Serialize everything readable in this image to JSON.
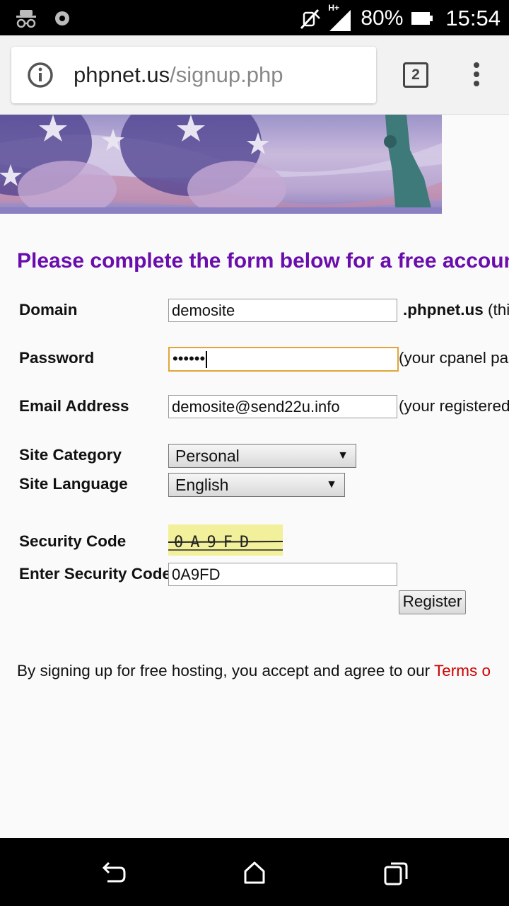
{
  "status_bar": {
    "battery": "80%",
    "time": "15:54",
    "network": "H+",
    "icons": [
      "incognito-icon",
      "sync-icon",
      "mute-icon",
      "signal-icon",
      "battery-icon"
    ]
  },
  "browser": {
    "url_host": "phpnet.us",
    "url_path": "/signup.php",
    "tab_count": "2"
  },
  "form": {
    "heading": "Please complete the form below for a free accoun",
    "domain": {
      "label": "Domain",
      "value": "demosite",
      "suffix_bold": ".phpnet.us",
      "suffix_note": "(thi"
    },
    "password": {
      "label": "Password",
      "value": "••••••",
      "suffix": "(your cpanel pa"
    },
    "email": {
      "label": "Email Address",
      "value": "demosite@send22u.info",
      "suffix": "(your registered"
    },
    "site_category": {
      "label": "Site Category",
      "selected": "Personal"
    },
    "site_language": {
      "label": "Site Language",
      "selected": "English"
    },
    "security_code": {
      "label": "Security Code",
      "captcha_text": "0A9FD"
    },
    "enter_security_code": {
      "label": "Enter Security Code",
      "value": "0A9FD"
    },
    "register_label": "Register"
  },
  "agreement": {
    "text": "By signing up for free hosting, you accept and agree to our ",
    "link": "Terms o"
  },
  "colors": {
    "heading": "#6a0dad",
    "link": "#cc0000",
    "focus_border": "#e0a63a",
    "captcha_bg": "#f2f09a"
  }
}
